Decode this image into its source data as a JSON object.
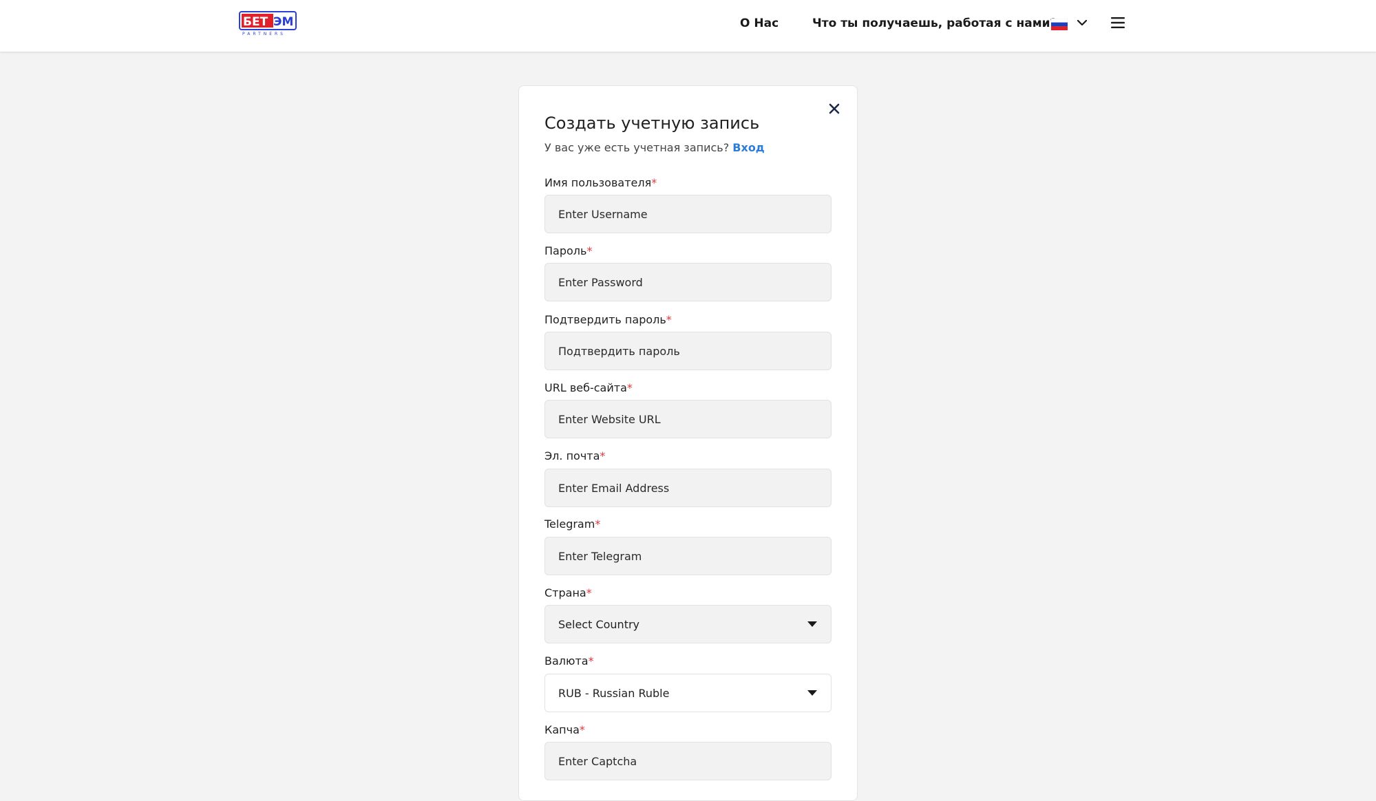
{
  "header": {
    "logo_text": "БЕТЭМ",
    "logo_subtext": "PARTNERS",
    "nav": {
      "about": "О Нас",
      "benefits": "Что ты получаешь, работая с нами?"
    },
    "language_flag": "flag-russia-icon",
    "menu_icon": "hamburger-menu-icon"
  },
  "form": {
    "title": "Создать учетную запись",
    "subtitle": "У вас уже есть учетная запись?",
    "login_link": "Вход",
    "required_mark": "*",
    "fields": {
      "username": {
        "label": "Имя пользователя",
        "placeholder": "Enter Username"
      },
      "password": {
        "label": "Пароль",
        "placeholder": "Enter Password"
      },
      "confirm_password": {
        "label": "Подтвердить пароль",
        "placeholder": "Подтвердить пароль"
      },
      "website": {
        "label": "URL веб-сайта",
        "placeholder": "Enter Website URL"
      },
      "email": {
        "label": "Эл. почта",
        "placeholder": "Enter Email Address"
      },
      "telegram": {
        "label": "Telegram",
        "placeholder": "Enter Telegram"
      },
      "country": {
        "label": "Страна",
        "value": "Select Country"
      },
      "currency": {
        "label": "Валюта",
        "value": "RUB - Russian Ruble"
      },
      "captcha": {
        "label": "Капча",
        "placeholder": "Enter Captcha"
      }
    }
  },
  "colors": {
    "accent_link": "#2b7cdb",
    "required": "#e0353c",
    "logo_red": "#e0202a",
    "logo_blue": "#2a3fd6",
    "background": "#f3f3f3",
    "field_bg": "#f2f2f2"
  }
}
